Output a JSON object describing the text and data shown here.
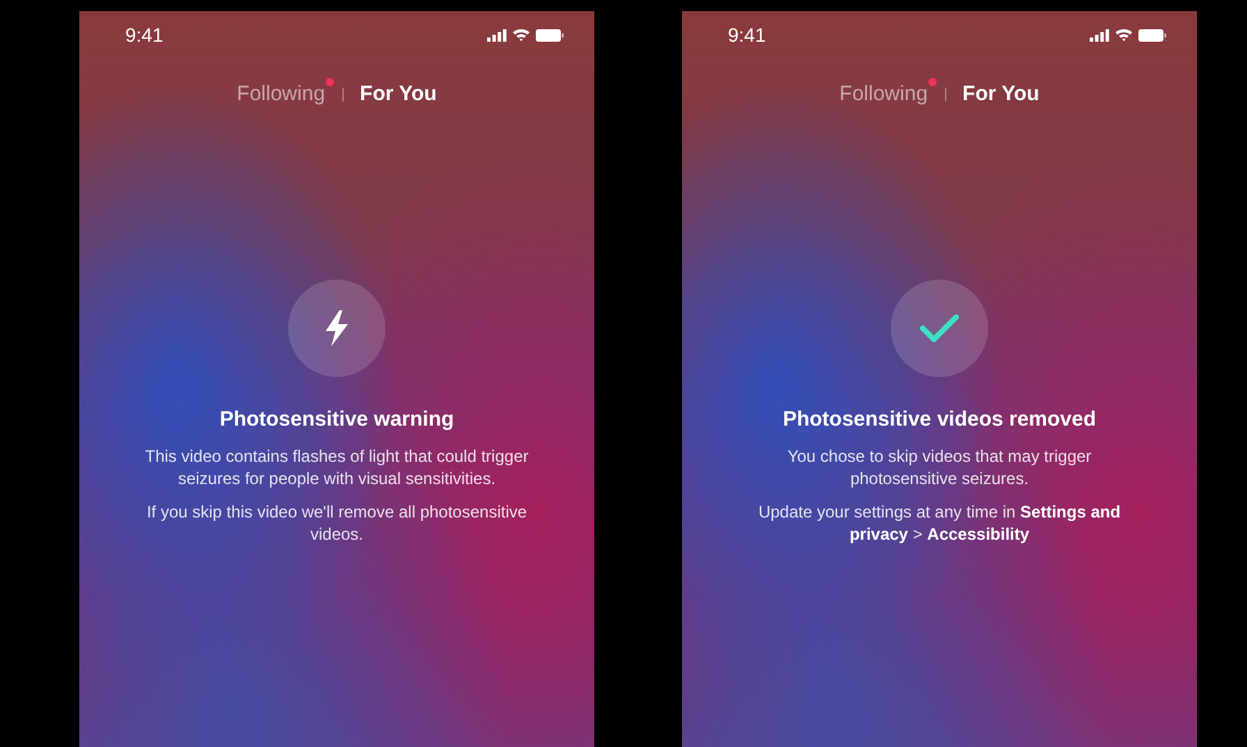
{
  "screens": [
    {
      "status_bar": {
        "time": "9:41"
      },
      "tabs": [
        {
          "label": "Following",
          "selected": false,
          "notification": true
        },
        {
          "label": "For You",
          "selected": true,
          "notification": false
        }
      ],
      "icon": {
        "kind": "bolt"
      },
      "title": "Photosensitive warning",
      "paragraphs": [
        "This video contains flashes of light that could trigger seizures for people with visual sensitivities.",
        "If you skip this video we'll remove all photosensitive videos."
      ]
    },
    {
      "status_bar": {
        "time": "9:41"
      },
      "tabs": [
        {
          "label": "Following",
          "selected": false,
          "notification": true
        },
        {
          "label": "For You",
          "selected": true,
          "notification": false
        }
      ],
      "icon": {
        "kind": "check"
      },
      "title": "Photosensitive videos removed",
      "paragraphs": [
        "You chose to skip videos that may trigger photosensitive seizures.",
        "Update your settings at any time in **Settings and privacy** > **Accessibility**"
      ]
    }
  ]
}
